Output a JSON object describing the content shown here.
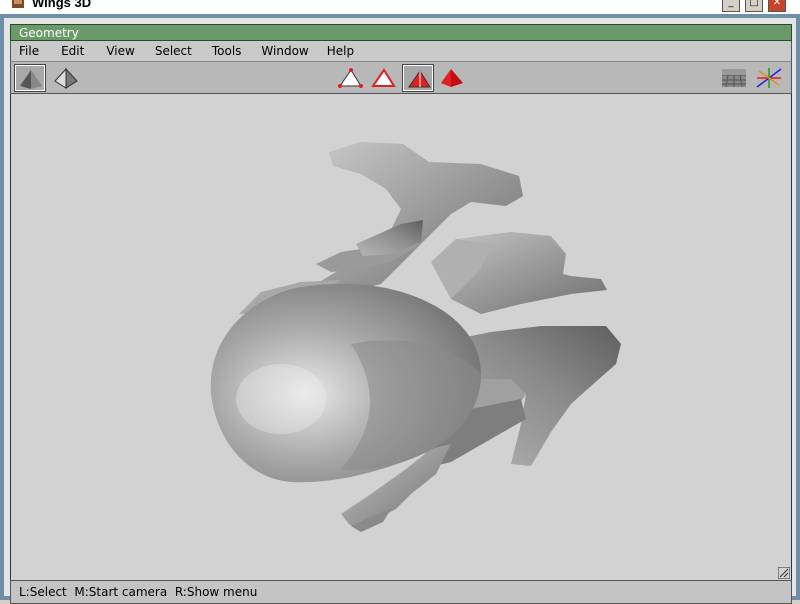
{
  "os_window": {
    "title": "Wings 3D"
  },
  "geometry_window": {
    "title": "Geometry"
  },
  "menu": {
    "items": [
      {
        "label": "File"
      },
      {
        "label": "Edit"
      },
      {
        "label": "View"
      },
      {
        "label": "Select"
      },
      {
        "label": "Tools"
      },
      {
        "label": "Window"
      },
      {
        "label": "Help"
      }
    ]
  },
  "toolbar": {
    "left": [
      {
        "icon": "smooth-shaded-pyramid-icon",
        "active": true
      },
      {
        "icon": "wireframe-pyramid-icon",
        "active": false
      }
    ],
    "selection_modes": [
      {
        "icon": "vertex-select-icon",
        "active": false
      },
      {
        "icon": "edge-select-icon",
        "active": false
      },
      {
        "icon": "face-select-icon",
        "active": true
      },
      {
        "icon": "body-select-icon",
        "active": false
      }
    ],
    "right": [
      {
        "icon": "groundplane-grid-icon"
      },
      {
        "icon": "axes-icon"
      }
    ]
  },
  "status": {
    "text": "L:Select  M:Start camera  R:Show menu"
  },
  "colors": {
    "frame": "#6f8fa8",
    "title_bar": "#6a9a6a",
    "viewport": "#d2d2d2",
    "selection_red": "#e02020"
  }
}
